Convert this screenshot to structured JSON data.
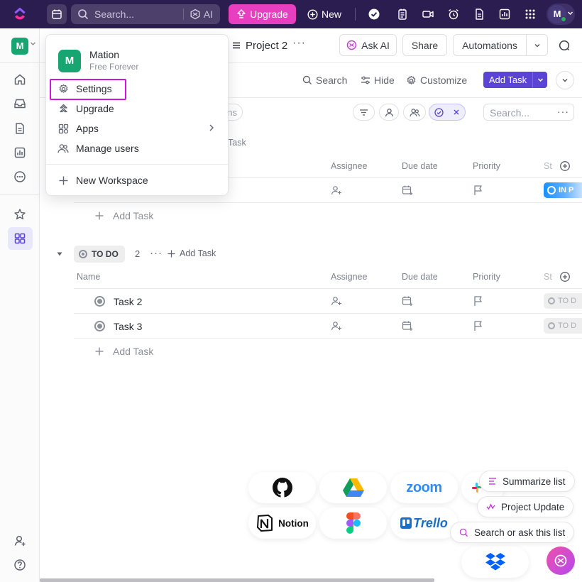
{
  "topbar": {
    "search_placeholder": "Search...",
    "ai_label": "AI",
    "upgrade_label": "Upgrade",
    "new_label": "New",
    "avatar_initial": "M"
  },
  "sidebar": {
    "workspace_initial": "M"
  },
  "header": {
    "project_title": "Project 2",
    "ask_ai_label": "Ask AI",
    "share_label": "Share",
    "automations_label": "Automations"
  },
  "toolbar": {
    "search_label": "Search",
    "hide_label": "Hide",
    "customize_label": "Customize",
    "add_task_label": "Add Task",
    "list_search_placeholder": "Search..."
  },
  "filters": {
    "partial_pill_text": "ns"
  },
  "group_in_progress": {
    "add_task_header_text": "Task",
    "columns": [
      "Assignee",
      "Due date",
      "Priority",
      "St"
    ],
    "status_chip": "IN P",
    "add_task_label": "Add Task"
  },
  "group_todo": {
    "label": "TO DO",
    "count": "2",
    "add_task_header": "Add Task",
    "columns": [
      "Name",
      "Assignee",
      "Due date",
      "Priority",
      "St"
    ],
    "tasks": [
      {
        "name": "Task 2",
        "status": "TO D"
      },
      {
        "name": "Task 3",
        "status": "TO D"
      }
    ],
    "add_task_label": "Add Task"
  },
  "dropdown": {
    "workspace_initial": "M",
    "workspace_name": "Mation",
    "plan": "Free Forever",
    "items": [
      {
        "label": "Settings",
        "icon": "gear-icon"
      },
      {
        "label": "Upgrade",
        "icon": "upgrade-icon"
      },
      {
        "label": "Apps",
        "icon": "apps-icon"
      },
      {
        "label": "Manage users",
        "icon": "users-icon"
      }
    ],
    "new_workspace_label": "New Workspace"
  },
  "integrations": {
    "notion_label": "Notion",
    "zoom_label": "zoom",
    "trello_label": "Trello"
  },
  "ai_suggestions": {
    "summarize": "Summarize list",
    "project_update": "Project Update",
    "search_ask": "Search or ask this list"
  },
  "colors": {
    "topbar_bg": "#2b1d4f",
    "upgrade_pink": "#e83ec0",
    "accent_purple": "#5b43d6",
    "workspace_green": "#17a672",
    "highlight_magenta": "#d313e0"
  }
}
